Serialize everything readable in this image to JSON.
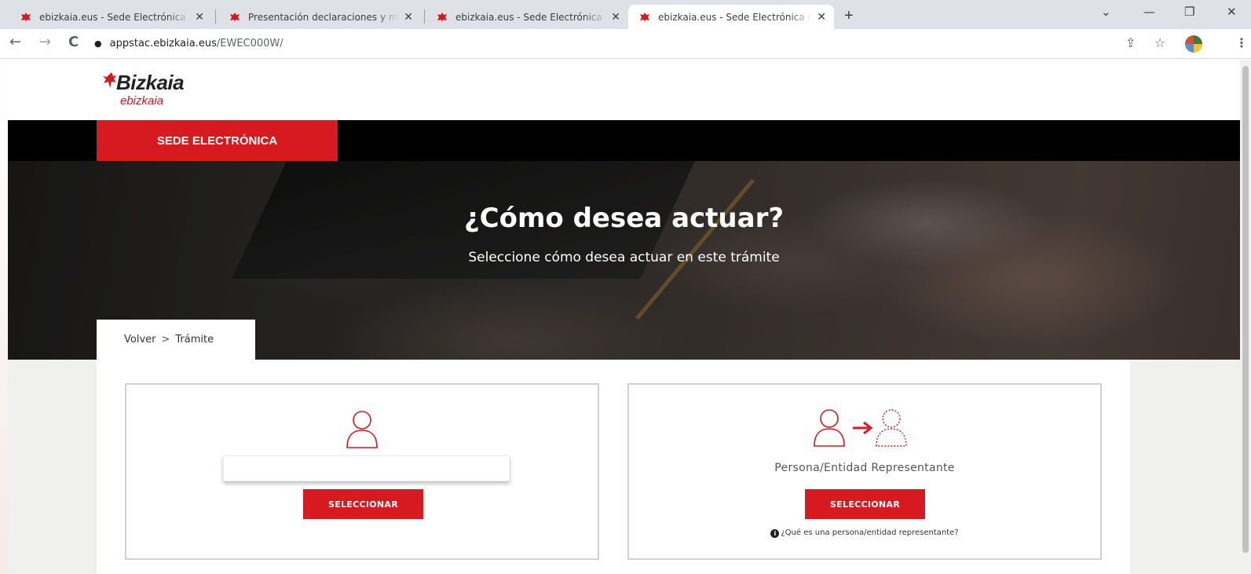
{
  "browser": {
    "tabs": [
      {
        "title": "ebizkaia.eus - Sede Electrónica de",
        "active": false
      },
      {
        "title": "Presentación declaraciones y mo",
        "active": false
      },
      {
        "title": "ebizkaia.eus - Sede Electrónica de",
        "active": false
      },
      {
        "title": "ebizkaia.eus - Sede Electrónica de",
        "active": true
      }
    ],
    "close_glyph": "✕",
    "new_tab_glyph": "+",
    "url_host": "appstac.ebizkaia.eus",
    "url_path": "/EWEC000W/",
    "lock_glyph": "🔒",
    "back_glyph": "←",
    "forward_glyph": "→",
    "reload_glyph": "C",
    "share_glyph": "⇪",
    "star_glyph": "☆",
    "menu_glyph": "⋮",
    "chevron_glyph": "⌄",
    "minimize_glyph": "—",
    "restore_glyph": "❐",
    "window_close_glyph": "✕"
  },
  "header": {
    "logo_title": "Bizkaia",
    "logo_sub": "ebizkaia",
    "brand_color": "#d71920"
  },
  "nav": {
    "sede_label": "SEDE ELECTRÓNICA"
  },
  "hero": {
    "title": "¿Cómo desea actuar?",
    "subtitle": "Seleccione cómo desea actuar en este trámite"
  },
  "breadcrumb": {
    "back": "Volver",
    "separator": ">",
    "current": "Trámite"
  },
  "cards": {
    "left": {
      "label": "",
      "button": "SELECCIONAR",
      "icon": "person-icon"
    },
    "right": {
      "label": "Persona/Entidad Representante",
      "button": "SELECCIONAR",
      "icon": "representative-icon",
      "help": "¿Qué es una persona/entidad representante?",
      "help_icon": "info-icon"
    }
  }
}
